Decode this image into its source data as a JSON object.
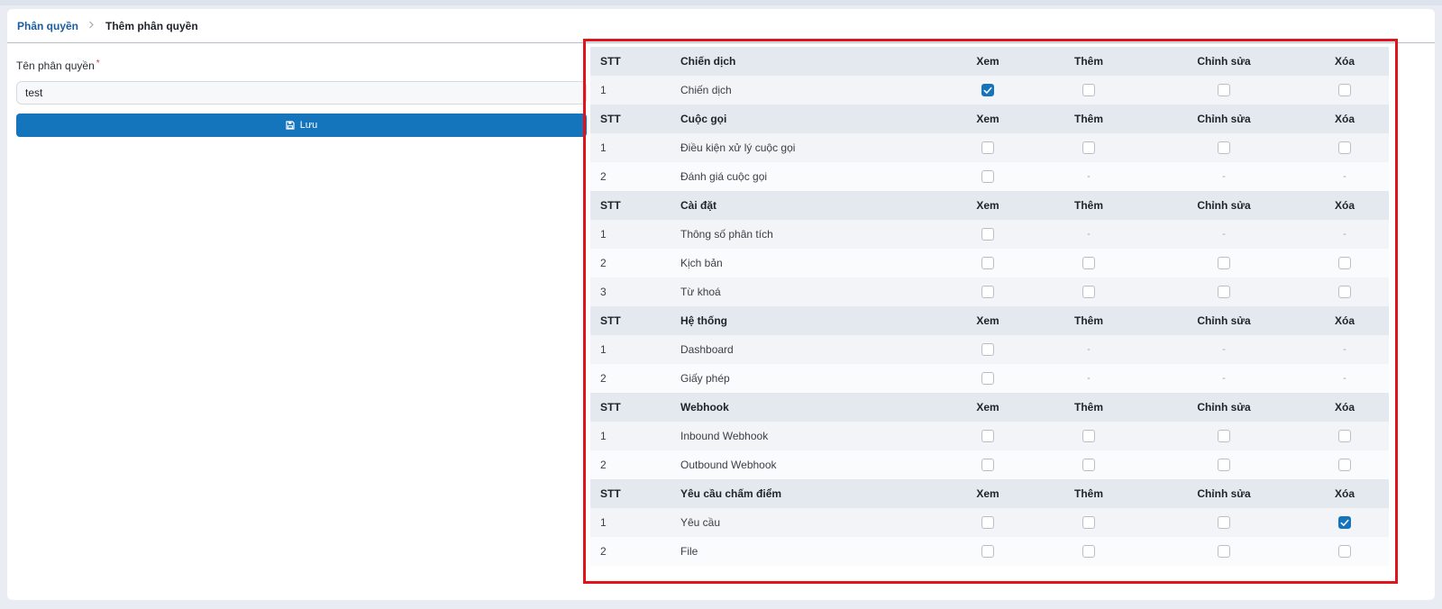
{
  "breadcrumb": {
    "parent": "Phân quyền",
    "current": "Thêm phân quyền"
  },
  "form": {
    "label": "Tên phân quyền",
    "required_mark": "*",
    "name_value": "test",
    "save_label": "Lưu",
    "save_icon": "floppy-disk-icon"
  },
  "columns": {
    "stt": "STT",
    "view": "Xem",
    "add": "Thêm",
    "edit": "Chỉnh sửa",
    "delete": "Xóa"
  },
  "groups": [
    {
      "title": "Chiến dịch",
      "items": [
        {
          "stt": "1",
          "name": "Chiến dịch",
          "view": true,
          "add": false,
          "edit": false,
          "delete": false
        }
      ]
    },
    {
      "title": "Cuộc gọi",
      "items": [
        {
          "stt": "1",
          "name": "Điều kiện xử lý cuộc gọi",
          "view": false,
          "add": false,
          "edit": false,
          "delete": false
        },
        {
          "stt": "2",
          "name": "Đánh giá cuộc gọi",
          "view": false,
          "add": null,
          "edit": null,
          "delete": null
        }
      ]
    },
    {
      "title": "Cài đặt",
      "items": [
        {
          "stt": "1",
          "name": "Thông số phân tích",
          "view": false,
          "add": null,
          "edit": null,
          "delete": null
        },
        {
          "stt": "2",
          "name": "Kịch bản",
          "view": false,
          "add": false,
          "edit": false,
          "delete": false
        },
        {
          "stt": "3",
          "name": "Từ khoá",
          "view": false,
          "add": false,
          "edit": false,
          "delete": false
        }
      ]
    },
    {
      "title": "Hệ thống",
      "items": [
        {
          "stt": "1",
          "name": "Dashboard",
          "view": false,
          "add": null,
          "edit": null,
          "delete": null
        },
        {
          "stt": "2",
          "name": "Giấy phép",
          "view": false,
          "add": null,
          "edit": null,
          "delete": null
        }
      ]
    },
    {
      "title": "Webhook",
      "items": [
        {
          "stt": "1",
          "name": "Inbound Webhook",
          "view": false,
          "add": false,
          "edit": false,
          "delete": false
        },
        {
          "stt": "2",
          "name": "Outbound Webhook",
          "view": false,
          "add": false,
          "edit": false,
          "delete": false
        }
      ]
    },
    {
      "title": "Yêu cầu chấm điểm",
      "items": [
        {
          "stt": "1",
          "name": "Yêu cầu",
          "view": false,
          "add": false,
          "edit": false,
          "delete": true
        },
        {
          "stt": "2",
          "name": "File",
          "view": false,
          "add": false,
          "edit": false,
          "delete": false
        }
      ]
    }
  ],
  "unavailable_mark": "-",
  "colors": {
    "accent": "#1475bd",
    "highlight_border": "#e0141b",
    "header_row": "#e4e9f0"
  }
}
